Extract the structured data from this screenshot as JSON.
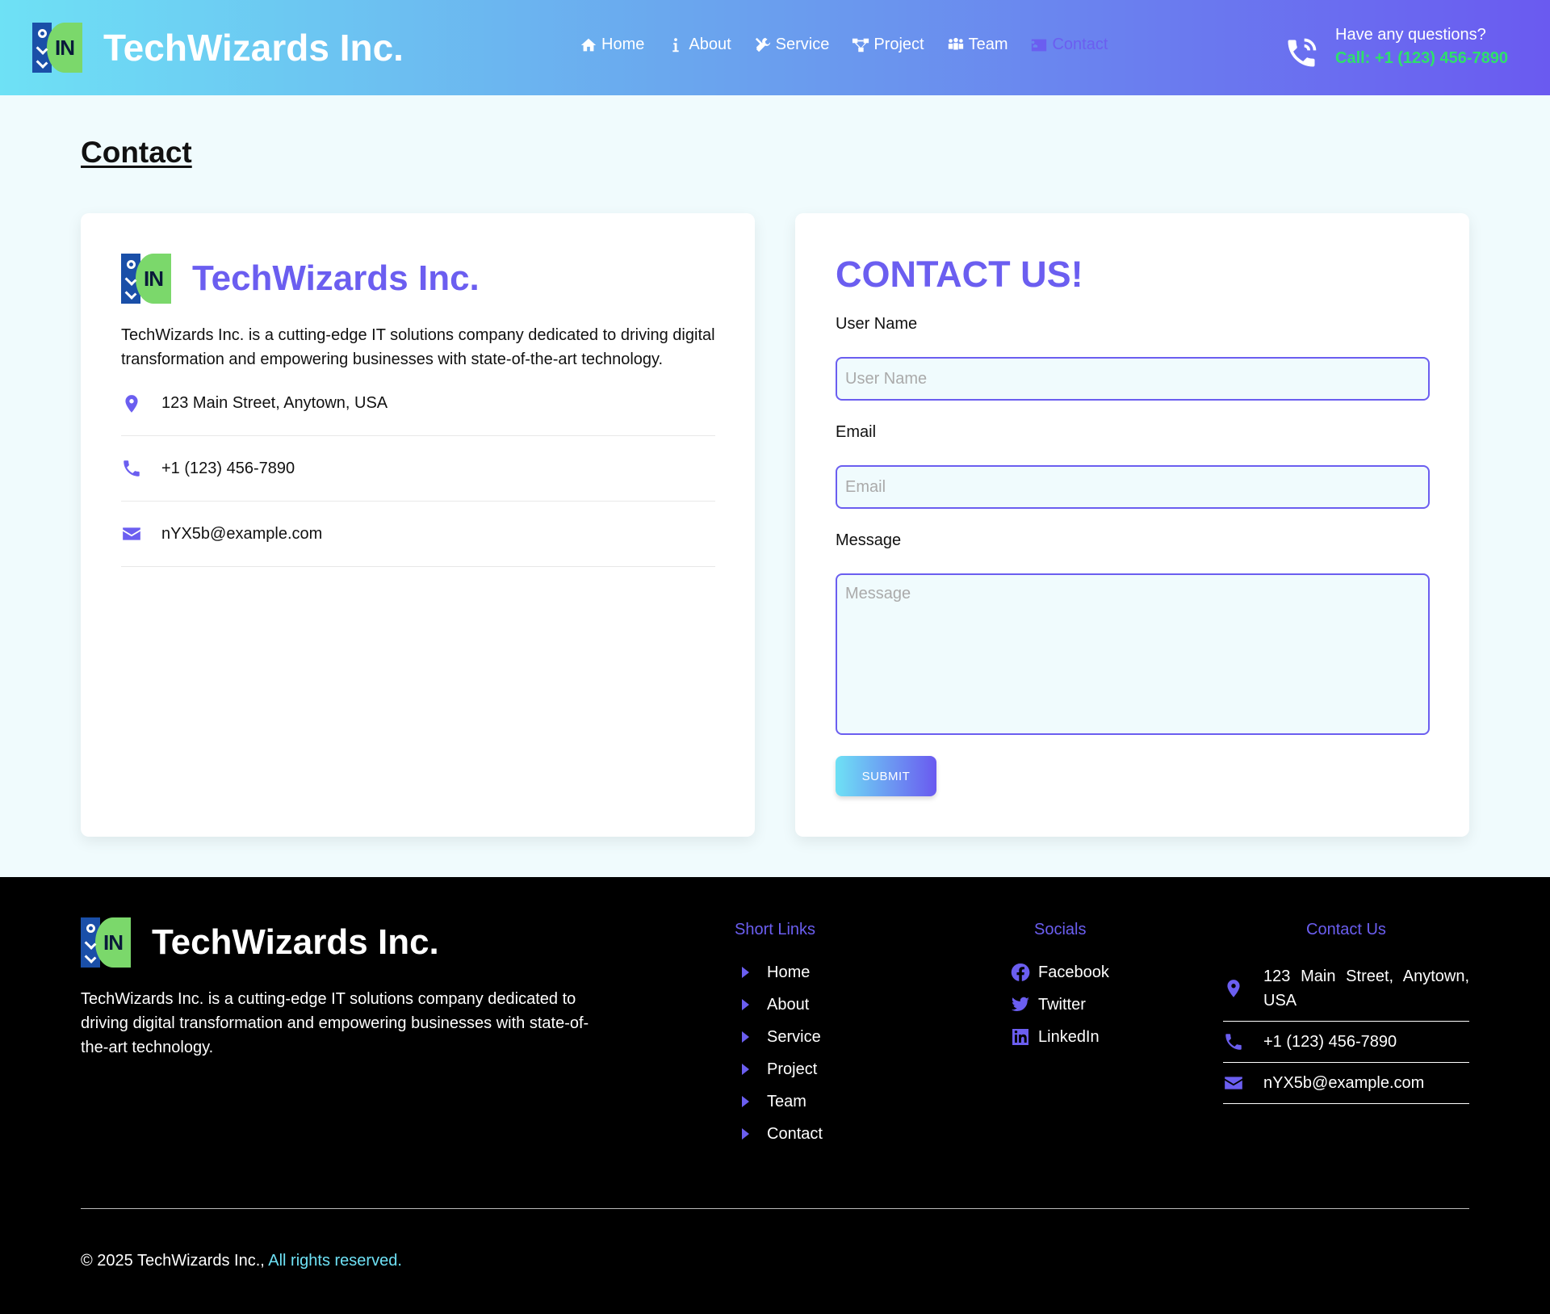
{
  "header": {
    "brand_name": "TechWizards Inc.",
    "logo_text": "IN",
    "nav": [
      {
        "label": "Home",
        "icon": "home-icon"
      },
      {
        "label": "About",
        "icon": "info-icon"
      },
      {
        "label": "Service",
        "icon": "tools-icon"
      },
      {
        "label": "Project",
        "icon": "project-icon"
      },
      {
        "label": "Team",
        "icon": "team-icon"
      },
      {
        "label": "Contact",
        "icon": "contact-card-icon",
        "active": true
      }
    ],
    "question": "Have any questions?",
    "call": "Call: +1 (123) 456-7890"
  },
  "page": {
    "title": "Contact"
  },
  "info_card": {
    "brand_name": "TechWizards Inc.",
    "description": "TechWizards Inc. is a cutting-edge IT solutions company dedicated to driving digital transformation and empowering businesses with state-of-the-art technology.",
    "address": "123 Main Street, Anytown, USA",
    "phone": "+1 (123) 456-7890",
    "email": "nYX5b@example.com"
  },
  "form": {
    "title": "CONTACT US!",
    "username_label": "User Name",
    "username_placeholder": "User Name",
    "email_label": "Email",
    "email_placeholder": "Email",
    "message_label": "Message",
    "message_placeholder": "Message",
    "submit_label": "SUBMIT"
  },
  "footer": {
    "brand_name": "TechWizards Inc.",
    "description": "TechWizards Inc. is a cutting-edge IT solutions company dedicated to driving digital transformation and empowering businesses with state-of-the-art technology.",
    "short_links_title": "Short Links",
    "short_links": [
      "Home",
      "About",
      "Service",
      "Project",
      "Team",
      "Contact"
    ],
    "socials_title": "Socials",
    "socials": [
      "Facebook",
      "Twitter",
      "LinkedIn"
    ],
    "contact_title": "Contact Us",
    "address": "123 Main Street, Anytown, USA",
    "phone": "+1 (123) 456-7890",
    "email": "nYX5b@example.com",
    "copyright": "© 2025 TechWizards Inc.,",
    "rights": "All rights reserved."
  },
  "colors": {
    "accent": "#6b5ef0",
    "header_gradient_start": "#6ee1f5",
    "header_gradient_end": "#6a5af0",
    "call_green": "#2ee06b",
    "page_bg": "#f0fbfd",
    "footer_bg": "#000000"
  }
}
